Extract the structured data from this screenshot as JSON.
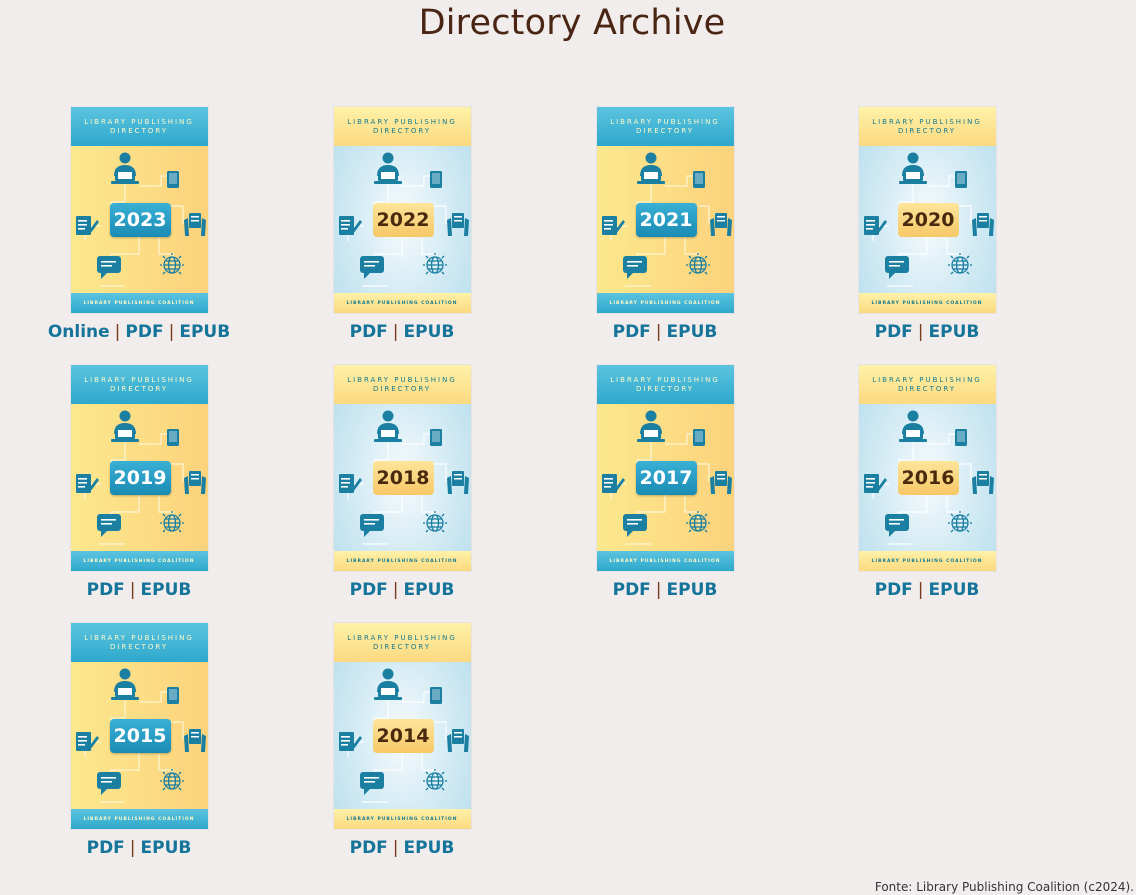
{
  "page": {
    "title": "Directory Archive",
    "footer": "Fonte: Library Publishing Coalition (c2024)."
  },
  "cover_text": {
    "line1": "LIBRARY PUBLISHING",
    "line2": "DIRECTORY",
    "publisher": "LIBRARY PUBLISHING COALITION"
  },
  "separator": "|",
  "directories": [
    {
      "year": "2023",
      "theme": "warm",
      "links": [
        "Online",
        "PDF",
        "EPUB"
      ]
    },
    {
      "year": "2022",
      "theme": "cool",
      "links": [
        "PDF",
        "EPUB"
      ]
    },
    {
      "year": "2021",
      "theme": "warm",
      "links": [
        "PDF",
        "EPUB"
      ]
    },
    {
      "year": "2020",
      "theme": "cool",
      "links": [
        "PDF",
        "EPUB"
      ]
    },
    {
      "year": "2019",
      "theme": "warm",
      "links": [
        "PDF",
        "EPUB"
      ]
    },
    {
      "year": "2018",
      "theme": "cool",
      "links": [
        "PDF",
        "EPUB"
      ]
    },
    {
      "year": "2017",
      "theme": "warm",
      "links": [
        "PDF",
        "EPUB"
      ]
    },
    {
      "year": "2016",
      "theme": "cool",
      "links": [
        "PDF",
        "EPUB"
      ]
    },
    {
      "year": "2015",
      "theme": "warm",
      "links": [
        "PDF",
        "EPUB"
      ]
    },
    {
      "year": "2014",
      "theme": "cool",
      "links": [
        "PDF",
        "EPUB"
      ]
    }
  ],
  "colors": {
    "background": "#f1eded",
    "title": "#4a2513",
    "link": "#15749a",
    "separator": "#7a3a20"
  },
  "icons": [
    "person-at-laptop-icon",
    "tablet-icon",
    "document-pencil-icon",
    "hands-holding-book-icon",
    "chat-bubble-icon",
    "globe-icon"
  ]
}
